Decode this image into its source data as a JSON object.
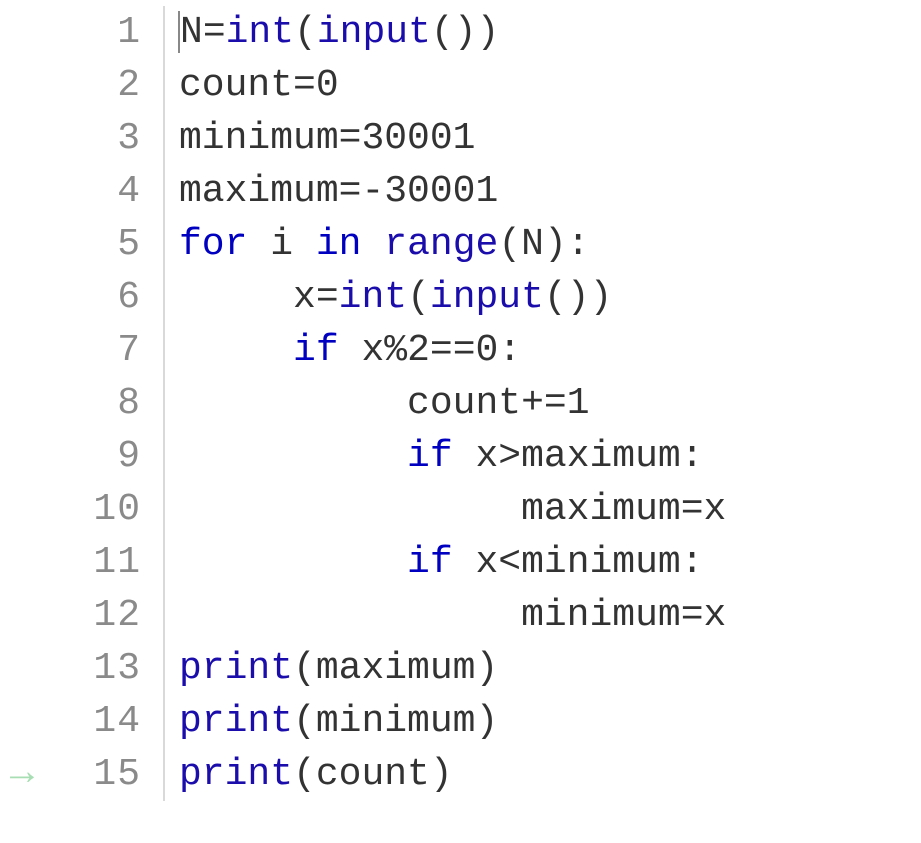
{
  "editor": {
    "current_line": 15,
    "cursor": {
      "line": 1,
      "col": 0
    },
    "lines": [
      {
        "num": "1",
        "tokens": [
          {
            "cls": "n",
            "text": "N"
          },
          {
            "cls": "o",
            "text": "="
          },
          {
            "cls": "b",
            "text": "int"
          },
          {
            "cls": "o",
            "text": "("
          },
          {
            "cls": "b",
            "text": "input"
          },
          {
            "cls": "o",
            "text": "())"
          }
        ]
      },
      {
        "num": "2",
        "tokens": [
          {
            "cls": "n",
            "text": "count"
          },
          {
            "cls": "o",
            "text": "="
          },
          {
            "cls": "d",
            "text": "0"
          }
        ]
      },
      {
        "num": "3",
        "tokens": [
          {
            "cls": "n",
            "text": "minimum"
          },
          {
            "cls": "o",
            "text": "="
          },
          {
            "cls": "d",
            "text": "30001"
          }
        ]
      },
      {
        "num": "4",
        "tokens": [
          {
            "cls": "n",
            "text": "maximum"
          },
          {
            "cls": "o",
            "text": "=-"
          },
          {
            "cls": "d",
            "text": "30001"
          }
        ]
      },
      {
        "num": "5",
        "tokens": [
          {
            "cls": "k",
            "text": "for"
          },
          {
            "cls": "o",
            "text": " "
          },
          {
            "cls": "n",
            "text": "i"
          },
          {
            "cls": "o",
            "text": " "
          },
          {
            "cls": "k",
            "text": "in"
          },
          {
            "cls": "o",
            "text": " "
          },
          {
            "cls": "b",
            "text": "range"
          },
          {
            "cls": "o",
            "text": "("
          },
          {
            "cls": "n",
            "text": "N"
          },
          {
            "cls": "o",
            "text": "):"
          }
        ]
      },
      {
        "num": "6",
        "tokens": [
          {
            "cls": "o",
            "text": "     "
          },
          {
            "cls": "n",
            "text": "x"
          },
          {
            "cls": "o",
            "text": "="
          },
          {
            "cls": "b",
            "text": "int"
          },
          {
            "cls": "o",
            "text": "("
          },
          {
            "cls": "b",
            "text": "input"
          },
          {
            "cls": "o",
            "text": "())"
          }
        ]
      },
      {
        "num": "7",
        "tokens": [
          {
            "cls": "o",
            "text": "     "
          },
          {
            "cls": "k",
            "text": "if"
          },
          {
            "cls": "o",
            "text": " "
          },
          {
            "cls": "n",
            "text": "x"
          },
          {
            "cls": "o",
            "text": "%"
          },
          {
            "cls": "d",
            "text": "2"
          },
          {
            "cls": "o",
            "text": "=="
          },
          {
            "cls": "d",
            "text": "0"
          },
          {
            "cls": "o",
            "text": ":"
          }
        ]
      },
      {
        "num": "8",
        "tokens": [
          {
            "cls": "o",
            "text": "          "
          },
          {
            "cls": "n",
            "text": "count"
          },
          {
            "cls": "o",
            "text": "+="
          },
          {
            "cls": "d",
            "text": "1"
          }
        ]
      },
      {
        "num": "9",
        "tokens": [
          {
            "cls": "o",
            "text": "          "
          },
          {
            "cls": "k",
            "text": "if"
          },
          {
            "cls": "o",
            "text": " "
          },
          {
            "cls": "n",
            "text": "x"
          },
          {
            "cls": "o",
            "text": ">"
          },
          {
            "cls": "n",
            "text": "maximum"
          },
          {
            "cls": "o",
            "text": ":"
          }
        ]
      },
      {
        "num": "10",
        "tokens": [
          {
            "cls": "o",
            "text": "               "
          },
          {
            "cls": "n",
            "text": "maximum"
          },
          {
            "cls": "o",
            "text": "="
          },
          {
            "cls": "n",
            "text": "x"
          }
        ]
      },
      {
        "num": "11",
        "tokens": [
          {
            "cls": "o",
            "text": "          "
          },
          {
            "cls": "k",
            "text": "if"
          },
          {
            "cls": "o",
            "text": " "
          },
          {
            "cls": "n",
            "text": "x"
          },
          {
            "cls": "o",
            "text": "<"
          },
          {
            "cls": "n",
            "text": "minimum"
          },
          {
            "cls": "o",
            "text": ":"
          }
        ]
      },
      {
        "num": "12",
        "tokens": [
          {
            "cls": "o",
            "text": "               "
          },
          {
            "cls": "n",
            "text": "minimum"
          },
          {
            "cls": "o",
            "text": "="
          },
          {
            "cls": "n",
            "text": "x"
          }
        ]
      },
      {
        "num": "13",
        "tokens": [
          {
            "cls": "b",
            "text": "print"
          },
          {
            "cls": "o",
            "text": "("
          },
          {
            "cls": "n",
            "text": "maximum"
          },
          {
            "cls": "o",
            "text": ")"
          }
        ]
      },
      {
        "num": "14",
        "tokens": [
          {
            "cls": "b",
            "text": "print"
          },
          {
            "cls": "o",
            "text": "("
          },
          {
            "cls": "n",
            "text": "minimum"
          },
          {
            "cls": "o",
            "text": ")"
          }
        ]
      },
      {
        "num": "15",
        "tokens": [
          {
            "cls": "b",
            "text": "print"
          },
          {
            "cls": "o",
            "text": "("
          },
          {
            "cls": "n",
            "text": "count"
          },
          {
            "cls": "o",
            "text": ")"
          }
        ]
      }
    ]
  }
}
